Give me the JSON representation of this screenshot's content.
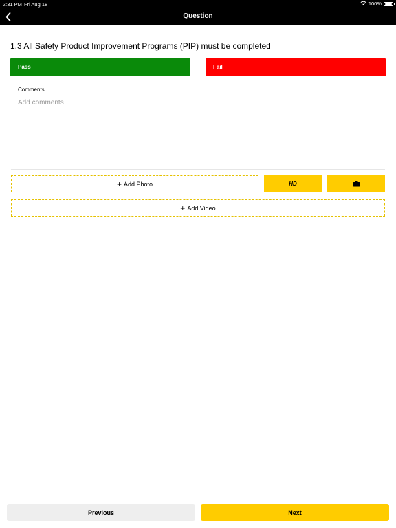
{
  "status_bar": {
    "time": "2:31 PM",
    "date": "Fri Aug 18",
    "battery": "100%"
  },
  "nav": {
    "title": "Question"
  },
  "question": {
    "text": "1.3 All Safety Product Improvement Programs (PIP) must be completed"
  },
  "result": {
    "pass_label": "Pass",
    "fail_label": "Fail"
  },
  "comments": {
    "label": "Comments",
    "placeholder": "Add comments",
    "value": ""
  },
  "media": {
    "add_photo_label": "Add Photo",
    "hd_label": "HD",
    "add_video_label": "Add Video",
    "plus_glyph": "+",
    "camera_icon": "camera-icon"
  },
  "footer": {
    "previous_label": "Previous",
    "next_label": "Next"
  },
  "colors": {
    "pass": "#0a8a0a",
    "fail": "#ff0000",
    "accent": "#ffcc00",
    "header": "#000000"
  }
}
